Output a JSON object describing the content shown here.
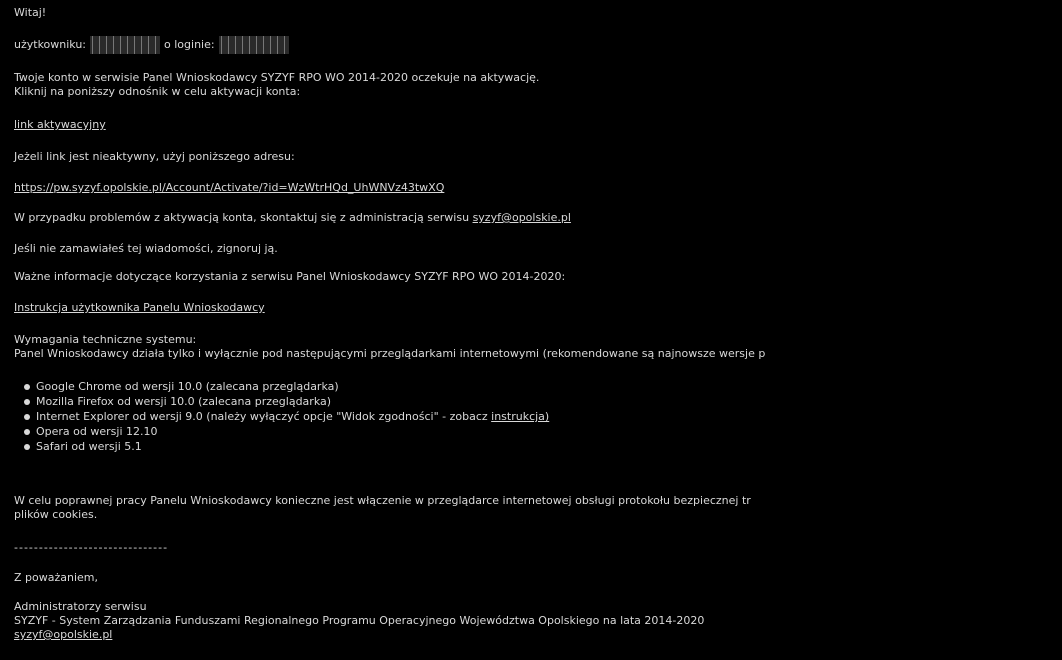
{
  "greeting": "Witaj!",
  "user_line": {
    "prefix": "użytkowniku:",
    "middle": "o loginie:"
  },
  "account_pending": "Twoje konto w serwisie Panel Wnioskodawcy SYZYF RPO WO 2014-2020 oczekuje na aktywację.",
  "click_instruction": "Kliknij na poniższy odnośnik w celu aktywacji konta:",
  "activation_link": "link aktywacyjny",
  "inactive_link_note": "Jeżeli link jest nieaktywny, użyj poniższego adresu:",
  "activation_url": "https://pw.syzyf.opolskie.pl/Account/Activate/?id=WzWtrHQd_UhWNVz43twXQ",
  "problem_contact_text": "W przypadku problemów z aktywacją konta, skontaktuj się z administracją serwisu",
  "contact_email": "syzyf@opolskie.pl",
  "ignore_note": "Jeśli nie zamawiałeś tej wiadomości, zignoruj ją.",
  "important_info": "Ważne informacje dotyczące korzystania z serwisu Panel Wnioskodawcy SYZYF RPO WO 2014-2020:",
  "info_link": "Instrukcja użytkownika Panelu Wnioskodawcy",
  "requirements_title": "Wymagania techniczne systemu:",
  "requirements_text": "Panel Wnioskodawcy działa tylko i wyłącznie pod następującymi przeglądarkami internetowymi (rekomendowane są najnowsze wersje p",
  "browsers": [
    {
      "text": "Google Chrome od wersji 10.0 (zalecana przeglądarka)",
      "link": ""
    },
    {
      "text": "Mozilla Firefox od wersji 10.0 (zalecana przeglądarka)",
      "link": ""
    },
    {
      "text": "Internet Explorer od wersji 9.0 (należy wyłączyć opcje \"Widok zgodności\" - zobacz",
      "link": "instrukcja)"
    },
    {
      "text": "Opera od wersji 12.10",
      "link": ""
    },
    {
      "text": "Safari od wersji 5.1",
      "link": ""
    }
  ],
  "cookies_text_1": "W celu poprawnej pracy Panelu Wnioskodawcy konieczne jest włączenie w przeglądarce internetowej obsługi protokołu bezpiecznej tr",
  "cookies_text_2": "plików cookies.",
  "separator": "-------------------------------",
  "regards": "Z poważaniem,",
  "admins": "Administratorzy serwisu",
  "system_full_name": "SYZYF - System Zarządzania Funduszami Regionalnego Programu Operacyjnego Województwa Opolskiego na lata 2014-2020",
  "footer_email": "syzyf@opolskie.pl"
}
